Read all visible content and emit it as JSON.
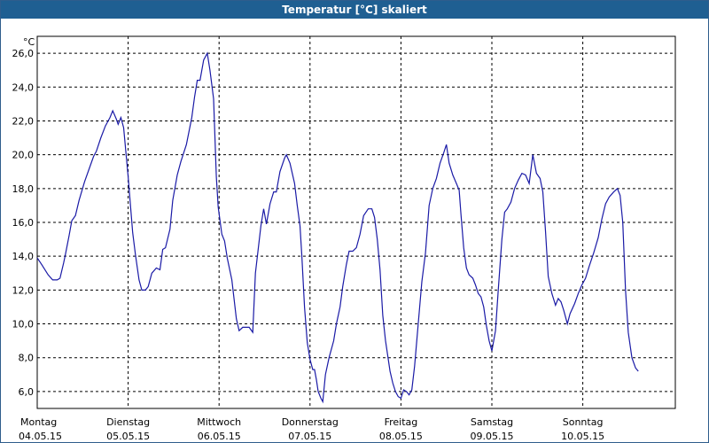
{
  "window": {
    "title": "Temperatur [°C] skaliert"
  },
  "colors": {
    "title_bar": "#1f5f92",
    "series_line": "#1a1aa6",
    "grid": "#000000"
  },
  "chart_data": {
    "type": "line",
    "title": "Temperatur [°C] skaliert",
    "ylabel": "°C",
    "ylim": [
      5.0,
      27.0
    ],
    "yticks": [
      "26,0",
      "24,0",
      "22,0",
      "20,0",
      "18,0",
      "16,0",
      "14,0",
      "12,0",
      "10,0",
      "8,0",
      "6,0"
    ],
    "x_day_labels": [
      {
        "day": "Montag",
        "date": "04.05.15"
      },
      {
        "day": "Dienstag",
        "date": "05.05.15"
      },
      {
        "day": "Mittwoch",
        "date": "06.05.15"
      },
      {
        "day": "Donnerstag",
        "date": "07.05.15"
      },
      {
        "day": "Freitag",
        "date": "08.05.15"
      },
      {
        "day": "Samstag",
        "date": "09.05.15"
      },
      {
        "day": "Sonntag",
        "date": "10.05.15"
      }
    ],
    "grid": "dashed",
    "series": [
      {
        "points": [
          [
            0.0,
            13.9
          ],
          [
            0.05,
            13.5
          ],
          [
            0.12,
            12.9
          ],
          [
            0.17,
            12.6
          ],
          [
            0.22,
            12.6
          ],
          [
            0.25,
            12.7
          ],
          [
            0.29,
            13.6
          ],
          [
            0.31,
            14.1
          ],
          [
            0.35,
            15.2
          ],
          [
            0.38,
            16.1
          ],
          [
            0.42,
            16.4
          ],
          [
            0.46,
            17.3
          ],
          [
            0.52,
            18.4
          ],
          [
            0.58,
            19.3
          ],
          [
            0.62,
            19.9
          ],
          [
            0.65,
            20.2
          ],
          [
            0.7,
            21.0
          ],
          [
            0.75,
            21.7
          ],
          [
            0.8,
            22.2
          ],
          [
            0.83,
            22.6
          ],
          [
            0.87,
            22.1
          ],
          [
            0.89,
            21.8
          ],
          [
            0.92,
            22.2
          ],
          [
            0.95,
            21.6
          ],
          [
            1.0,
            18.7
          ],
          [
            1.05,
            15.4
          ],
          [
            1.08,
            14.1
          ],
          [
            1.12,
            12.6
          ],
          [
            1.15,
            12.0
          ],
          [
            1.19,
            12.0
          ],
          [
            1.22,
            12.2
          ],
          [
            1.26,
            13.0
          ],
          [
            1.31,
            13.3
          ],
          [
            1.35,
            13.2
          ],
          [
            1.38,
            14.4
          ],
          [
            1.41,
            14.5
          ],
          [
            1.46,
            15.6
          ],
          [
            1.49,
            17.3
          ],
          [
            1.54,
            18.8
          ],
          [
            1.58,
            19.6
          ],
          [
            1.64,
            20.6
          ],
          [
            1.7,
            22.2
          ],
          [
            1.73,
            23.4
          ],
          [
            1.76,
            24.4
          ],
          [
            1.79,
            24.4
          ],
          [
            1.83,
            25.6
          ],
          [
            1.87,
            26.0
          ],
          [
            1.9,
            25.0
          ],
          [
            1.94,
            23.3
          ],
          [
            1.97,
            18.7
          ],
          [
            1.99,
            16.9
          ],
          [
            2.03,
            15.3
          ],
          [
            2.06,
            14.9
          ],
          [
            2.09,
            13.9
          ],
          [
            2.14,
            12.6
          ],
          [
            2.19,
            10.3
          ],
          [
            2.22,
            9.6
          ],
          [
            2.26,
            9.8
          ],
          [
            2.33,
            9.8
          ],
          [
            2.37,
            9.5
          ],
          [
            2.4,
            13.0
          ],
          [
            2.46,
            15.8
          ],
          [
            2.49,
            16.8
          ],
          [
            2.52,
            15.9
          ],
          [
            2.56,
            17.1
          ],
          [
            2.6,
            17.8
          ],
          [
            2.63,
            17.8
          ],
          [
            2.67,
            19.0
          ],
          [
            2.72,
            19.8
          ],
          [
            2.74,
            20.0
          ],
          [
            2.78,
            19.5
          ],
          [
            2.83,
            18.3
          ],
          [
            2.86,
            17.0
          ],
          [
            2.89,
            15.8
          ],
          [
            2.91,
            14.0
          ],
          [
            2.94,
            11.0
          ],
          [
            2.97,
            8.9
          ],
          [
            3.0,
            7.9
          ],
          [
            3.03,
            7.3
          ],
          [
            3.05,
            7.3
          ],
          [
            3.07,
            6.7
          ],
          [
            3.09,
            6.0
          ],
          [
            3.12,
            5.6
          ],
          [
            3.14,
            5.4
          ],
          [
            3.17,
            7.0
          ],
          [
            3.21,
            8.0
          ],
          [
            3.26,
            9.0
          ],
          [
            3.29,
            10.0
          ],
          [
            3.33,
            11.0
          ],
          [
            3.36,
            12.2
          ],
          [
            3.4,
            13.5
          ],
          [
            3.43,
            14.3
          ],
          [
            3.47,
            14.3
          ],
          [
            3.51,
            14.5
          ],
          [
            3.55,
            15.3
          ],
          [
            3.59,
            16.4
          ],
          [
            3.64,
            16.8
          ],
          [
            3.68,
            16.8
          ],
          [
            3.71,
            16.3
          ],
          [
            3.74,
            15.0
          ],
          [
            3.77,
            13.2
          ],
          [
            3.8,
            10.5
          ],
          [
            3.83,
            9.0
          ],
          [
            3.88,
            7.2
          ],
          [
            3.91,
            6.5
          ],
          [
            3.94,
            6.0
          ],
          [
            3.97,
            5.7
          ],
          [
            4.0,
            5.6
          ],
          [
            4.03,
            6.1
          ],
          [
            4.06,
            6.0
          ],
          [
            4.09,
            5.8
          ],
          [
            4.12,
            6.1
          ],
          [
            4.15,
            7.5
          ],
          [
            4.19,
            10.0
          ],
          [
            4.23,
            12.5
          ],
          [
            4.27,
            14.2
          ],
          [
            4.31,
            17.0
          ],
          [
            4.35,
            18.0
          ],
          [
            4.39,
            18.6
          ],
          [
            4.43,
            19.5
          ],
          [
            4.47,
            20.1
          ],
          [
            4.5,
            20.6
          ],
          [
            4.53,
            19.5
          ],
          [
            4.57,
            18.8
          ],
          [
            4.61,
            18.3
          ],
          [
            4.64,
            17.9
          ],
          [
            4.66,
            16.5
          ],
          [
            4.69,
            14.5
          ],
          [
            4.72,
            13.3
          ],
          [
            4.75,
            12.9
          ],
          [
            4.79,
            12.7
          ],
          [
            4.82,
            12.3
          ],
          [
            4.85,
            11.8
          ],
          [
            4.88,
            11.6
          ],
          [
            4.91,
            11.0
          ],
          [
            4.94,
            9.9
          ],
          [
            4.97,
            9.0
          ],
          [
            5.0,
            8.4
          ],
          [
            5.04,
            9.6
          ],
          [
            5.07,
            12.0
          ],
          [
            5.11,
            15.0
          ],
          [
            5.14,
            16.6
          ],
          [
            5.17,
            16.8
          ],
          [
            5.21,
            17.2
          ],
          [
            5.25,
            18.0
          ],
          [
            5.29,
            18.5
          ],
          [
            5.33,
            18.9
          ],
          [
            5.37,
            18.8
          ],
          [
            5.41,
            18.3
          ],
          [
            5.45,
            20.0
          ],
          [
            5.49,
            18.9
          ],
          [
            5.53,
            18.6
          ],
          [
            5.56,
            17.8
          ],
          [
            5.59,
            15.5
          ],
          [
            5.62,
            12.8
          ],
          [
            5.66,
            11.8
          ],
          [
            5.7,
            11.1
          ],
          [
            5.73,
            11.5
          ],
          [
            5.76,
            11.3
          ],
          [
            5.79,
            10.8
          ],
          [
            5.83,
            10.0
          ],
          [
            5.86,
            10.6
          ],
          [
            5.91,
            11.2
          ],
          [
            5.95,
            11.8
          ],
          [
            5.99,
            12.3
          ],
          [
            6.03,
            12.7
          ],
          [
            6.07,
            13.4
          ],
          [
            6.12,
            14.2
          ],
          [
            6.17,
            15.1
          ],
          [
            6.21,
            16.2
          ],
          [
            6.25,
            17.1
          ],
          [
            6.29,
            17.5
          ],
          [
            6.34,
            17.8
          ],
          [
            6.38,
            18.0
          ],
          [
            6.41,
            17.6
          ],
          [
            6.44,
            16.0
          ],
          [
            6.47,
            12.0
          ],
          [
            6.5,
            9.5
          ],
          [
            6.54,
            8.0
          ],
          [
            6.58,
            7.4
          ],
          [
            6.61,
            7.2
          ]
        ]
      }
    ]
  }
}
